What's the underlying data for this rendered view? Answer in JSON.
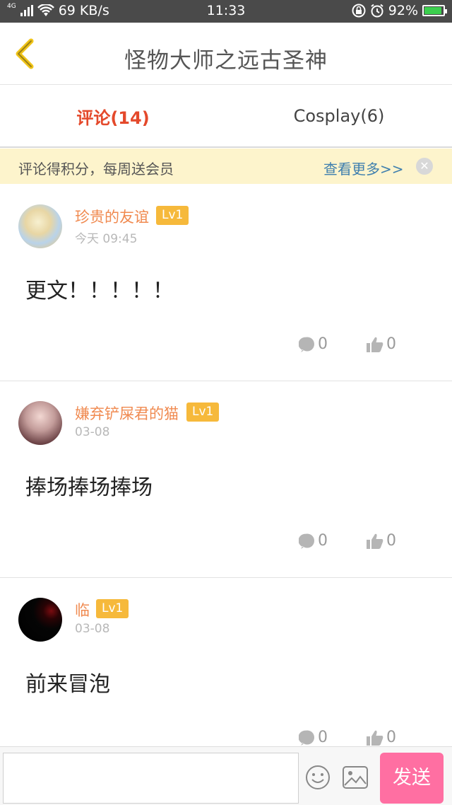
{
  "status_bar": {
    "signal_tag": "4G",
    "network_speed": "69 KB/s",
    "time": "11:33",
    "battery": "92%",
    "battery_level": 0.92
  },
  "header": {
    "title": "怪物大师之远古圣神"
  },
  "tabs": [
    {
      "label": "评论(14)",
      "active": true
    },
    {
      "label": "Cosplay(6)",
      "active": false
    }
  ],
  "notice": {
    "text": "评论得积分，每周送会员",
    "more": "查看更多>>",
    "close": "✕"
  },
  "comments": [
    {
      "user": "珍贵的友谊",
      "level": "Lv1",
      "time": "今天 09:45",
      "text": "更文！！！！！",
      "replies": "0",
      "likes": "0"
    },
    {
      "user": "嫌弃铲屎君的猫",
      "level": "Lv1",
      "time": "03-08",
      "text": "捧场捧场捧场",
      "replies": "0",
      "likes": "0"
    },
    {
      "user": "临",
      "level": "Lv1",
      "time": "03-08",
      "text": "前来冒泡",
      "replies": "0",
      "likes": "0"
    }
  ],
  "composer": {
    "placeholder": "",
    "send_label": "发送"
  },
  "colors": {
    "accent_tab": "#e4492b",
    "username": "#f08a50",
    "level_badge": "#f6b93b",
    "notice_bg": "#fdf4cc",
    "send_button": "#ff6fa2",
    "back_arrow": "#f0c419"
  },
  "icons": [
    "back-arrow-icon",
    "wifi-icon",
    "signal-icon",
    "lock-icon",
    "alarm-icon",
    "battery-icon",
    "comment-icon",
    "thumbs-up-icon",
    "emoji-icon",
    "image-icon",
    "close-icon"
  ]
}
